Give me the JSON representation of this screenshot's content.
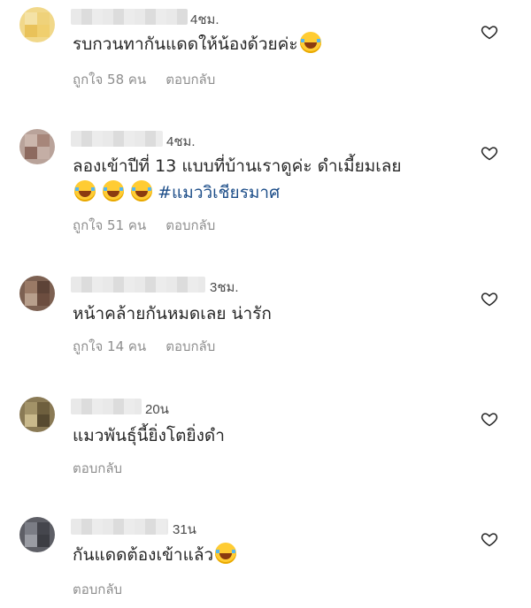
{
  "reply_label": "ตอบกลับ",
  "comments": [
    {
      "time": "4ชม.",
      "text": "รบกวนทากันแดดให้น้องด้วยค่ะ",
      "emoji_count": 1,
      "likes": "ถูกใจ 58 คน"
    },
    {
      "time": "4ชม.",
      "text": "ลองเข้าปีที่ 13 แบบที่บ้านเราดูค่ะ ดำเมี้ยมเลย",
      "emoji_count": 3,
      "hashtag": "#แมววิเชียรมาศ",
      "likes": "ถูกใจ 51 คน"
    },
    {
      "time": "3ชม.",
      "text": "หน้าคล้ายกันหมดเลย น่ารัก",
      "emoji_count": 0,
      "likes": "ถูกใจ 14 คน"
    },
    {
      "time": "20น",
      "text": "แมวพันธุ์นี้ยิ่งโตยิ่งดำ",
      "emoji_count": 0,
      "likes": ""
    },
    {
      "time": "31น",
      "text": "กันแดดต้องเข้าแล้ว",
      "emoji_count": 1,
      "likes": ""
    }
  ]
}
